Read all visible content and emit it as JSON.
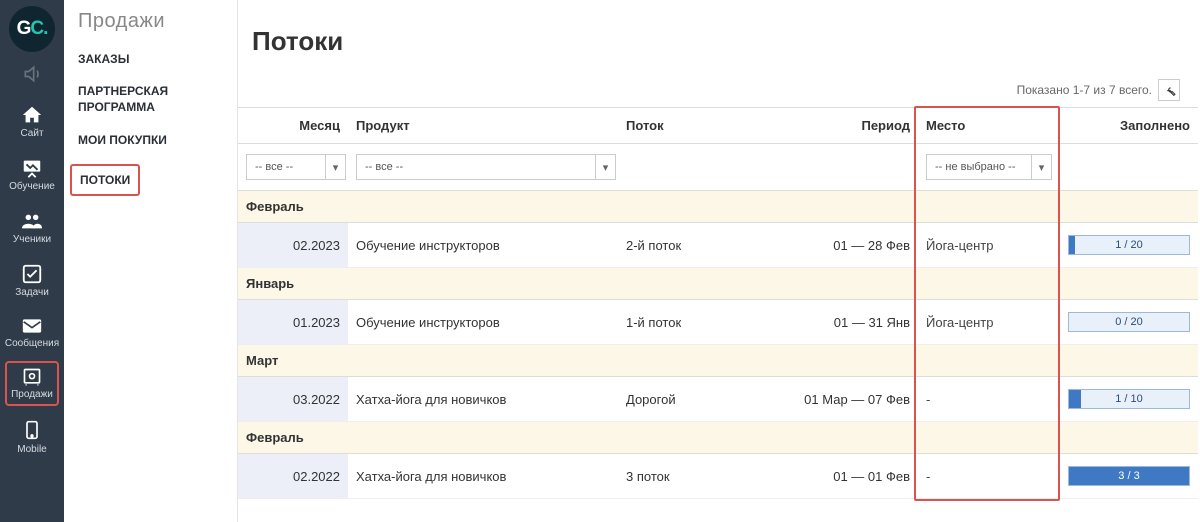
{
  "iconbar": {
    "logo": {
      "g": "G",
      "c": "C",
      "dot": "."
    },
    "items": [
      {
        "key": "sound",
        "label": "",
        "muted": true
      },
      {
        "key": "site",
        "label": "Сайт"
      },
      {
        "key": "learn",
        "label": "Обучение"
      },
      {
        "key": "students",
        "label": "Ученики"
      },
      {
        "key": "tasks",
        "label": "Задачи"
      },
      {
        "key": "messages",
        "label": "Сообщения"
      },
      {
        "key": "sales",
        "label": "Продажи",
        "active": true
      },
      {
        "key": "mobile",
        "label": "Mobile"
      }
    ]
  },
  "sidenav": {
    "title": "Продажи",
    "items": [
      {
        "label": "ЗАКАЗЫ"
      },
      {
        "label": "ПАРТНЕРСКАЯ ПРОГРАММА"
      },
      {
        "label": "МОИ ПОКУПКИ"
      },
      {
        "label": "ПОТОКИ",
        "active": true
      }
    ]
  },
  "main": {
    "title": "Потоки",
    "summary": "Показано 1-7 из 7 всего.",
    "columns": {
      "month": "Месяц",
      "product": "Продукт",
      "flow": "Поток",
      "period": "Период",
      "place": "Место",
      "fill": "Заполнено"
    },
    "filters": {
      "month": "-- все --",
      "product": "-- все --",
      "place": "-- не выбрано --"
    },
    "groups": [
      {
        "label": "Февраль",
        "rows": [
          {
            "month": "02.2023",
            "product": "Обучение инструкторов",
            "flow": "2-й поток",
            "period": "01 — 28 Фев",
            "place": "Йога-центр",
            "fill": {
              "current": 1,
              "total": 20
            }
          }
        ]
      },
      {
        "label": "Январь",
        "rows": [
          {
            "month": "01.2023",
            "product": "Обучение инструкторов",
            "flow": "1-й поток",
            "period": "01 — 31 Янв",
            "place": "Йога-центр",
            "fill": {
              "current": 0,
              "total": 20
            }
          }
        ]
      },
      {
        "label": "Март",
        "rows": [
          {
            "month": "03.2022",
            "product": "Хатха-йога для новичков",
            "flow": "Дорогой",
            "period": "01 Мар — 07 Фев",
            "place": "-",
            "fill": {
              "current": 1,
              "total": 10
            }
          }
        ]
      },
      {
        "label": "Февраль",
        "rows": [
          {
            "month": "02.2022",
            "product": "Хатха-йога для новичков",
            "flow": "3 поток",
            "period": "01 — 01 Фев",
            "place": "-",
            "fill": {
              "current": 3,
              "total": 3
            }
          }
        ]
      }
    ]
  }
}
